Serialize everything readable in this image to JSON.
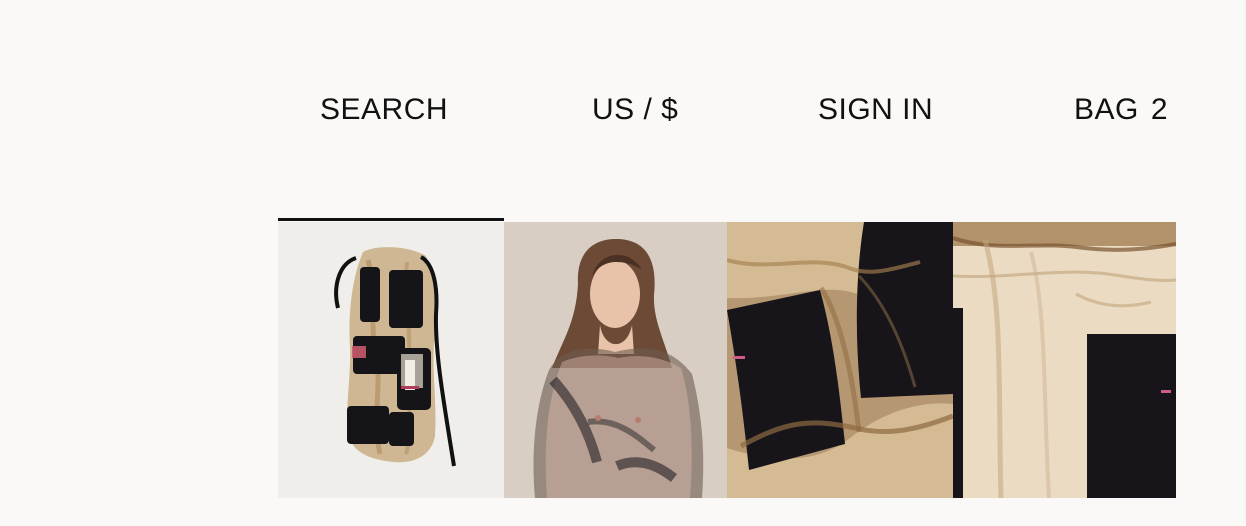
{
  "header": {
    "search_label": "SEARCH",
    "currency_label": "US / $",
    "signin_label": "SIGN IN",
    "bag_label": "BAG",
    "bag_count": "2"
  },
  "gallery": {
    "active_index": 1,
    "thumbnails": [
      {
        "name": "product-front-thumbnail"
      },
      {
        "name": "model-wearing-thumbnail"
      },
      {
        "name": "fabric-detail-thumbnail"
      },
      {
        "name": "closeup-detail-thumbnail"
      }
    ]
  },
  "colors": {
    "background": "#faf9f7",
    "text": "#111111",
    "active_indicator": "#111111",
    "sheer_fabric": "#b58f5a",
    "mohair_black": "#17151a",
    "accent_pink": "#ce5b8b"
  }
}
